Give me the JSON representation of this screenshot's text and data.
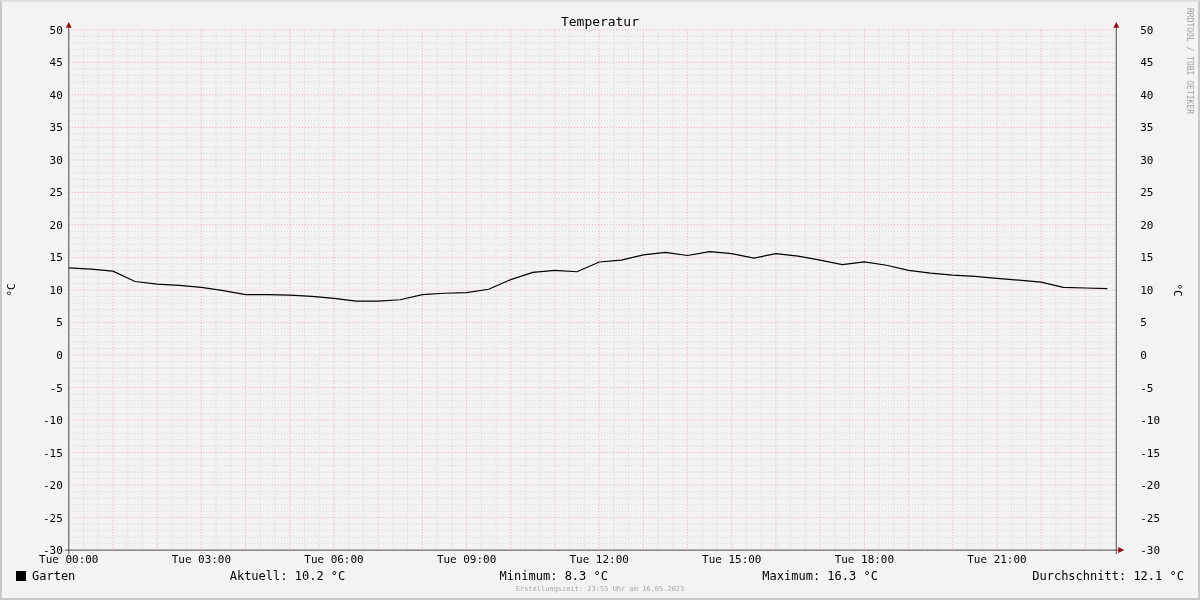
{
  "chart": {
    "chart_data": {
      "type": "line",
      "title": "Temperatur",
      "ylabel": "°C",
      "grid": true,
      "ylim": [
        -30,
        50
      ],
      "categories": [
        "Tue 00:00",
        null,
        null,
        null,
        null,
        null,
        "Tue 03:00",
        null,
        null,
        null,
        null,
        null,
        "Tue 06:00",
        null,
        null,
        null,
        null,
        null,
        "Tue 09:00",
        null,
        null,
        null,
        null,
        null,
        "Tue 12:00",
        null,
        null,
        null,
        null,
        null,
        "Tue 15:00",
        null,
        null,
        null,
        null,
        null,
        "Tue 18:00",
        null,
        null,
        null,
        null,
        null,
        "Tue 21:00",
        null,
        null,
        null,
        null,
        null
      ],
      "yticks": [
        -30,
        -25,
        -20,
        -15,
        -10,
        -5,
        0,
        5,
        10,
        15,
        20,
        25,
        30,
        35,
        40,
        45,
        50
      ],
      "series": [
        {
          "name": "Garten",
          "color": "#000000",
          "values": [
            13.4,
            13.2,
            12.9,
            11.3,
            10.9,
            10.7,
            10.4,
            9.9,
            9.3,
            9.3,
            9.2,
            9.0,
            8.7,
            8.3,
            8.3,
            8.5,
            9.3,
            9.5,
            9.6,
            10.1,
            11.6,
            12.7,
            13.0,
            12.8,
            14.3,
            14.6,
            15.4,
            15.8,
            15.3,
            15.9,
            15.6,
            14.9,
            15.6,
            15.2,
            14.6,
            13.9,
            14.3,
            13.8,
            13.0,
            12.6,
            12.3,
            12.1,
            11.8,
            11.5,
            11.2,
            10.4,
            10.3,
            10.2
          ]
        }
      ]
    },
    "right_axis": {
      "label": "°C",
      "ticks": [
        "50",
        "45",
        "40",
        "35",
        "30",
        "25",
        "20",
        "15",
        "10",
        "5",
        "0",
        "-5",
        "-10",
        "-15",
        "-20",
        "-25",
        "-30"
      ]
    },
    "credit": "RRDTOOL / TOBI OETIKER"
  },
  "legend": {
    "stats": [
      "Aktuell: 10.2 °C",
      "Minimum: 8.3 °C",
      "Maximum: 16.3 °C",
      "Durchschnitt: 12.1 °C"
    ]
  },
  "footer": "Erstellungszeit: 23:55 Uhr am 16.05.2023"
}
